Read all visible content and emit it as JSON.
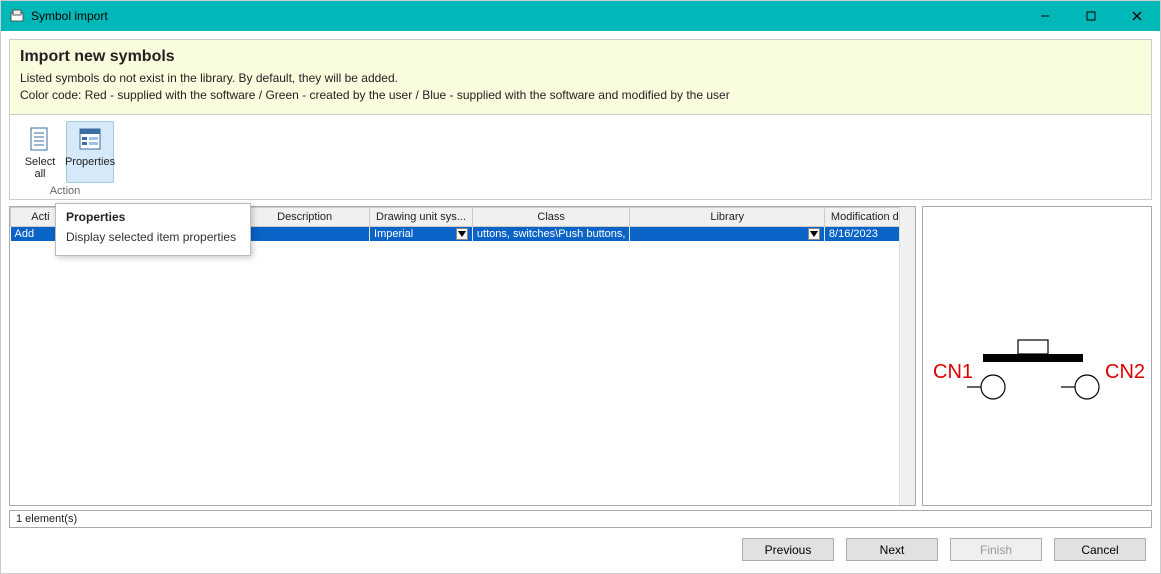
{
  "window": {
    "title": "Symbol import"
  },
  "info": {
    "heading": "Import new symbols",
    "line1": "Listed symbols do not exist in the library. By default, they will be added.",
    "line2": "Color code: Red - supplied with the software / Green - created by the user / Blue - supplied with the software and modified by the user"
  },
  "toolbar": {
    "group_label": "Action",
    "select_all": "Select all",
    "properties": "Properties"
  },
  "tooltip": {
    "title": "Properties",
    "body": "Display selected item properties"
  },
  "grid": {
    "columns": {
      "action": "Acti",
      "name": "",
      "description": "Description",
      "drawing_unit": "Drawing unit sys...",
      "class": "Class",
      "library": "Library",
      "modification_date": "Modification d..."
    },
    "rows": [
      {
        "action": "Add",
        "name": "",
        "description": "",
        "drawing_unit": "Imperial",
        "class": "uttons, switches\\Push buttons,",
        "library": "",
        "modification_date": "8/16/2023"
      }
    ]
  },
  "preview": {
    "left_label": "CN1",
    "right_label": "CN2"
  },
  "status": {
    "text": "1 element(s)"
  },
  "footer": {
    "previous": "Previous",
    "next": "Next",
    "finish": "Finish",
    "cancel": "Cancel"
  }
}
